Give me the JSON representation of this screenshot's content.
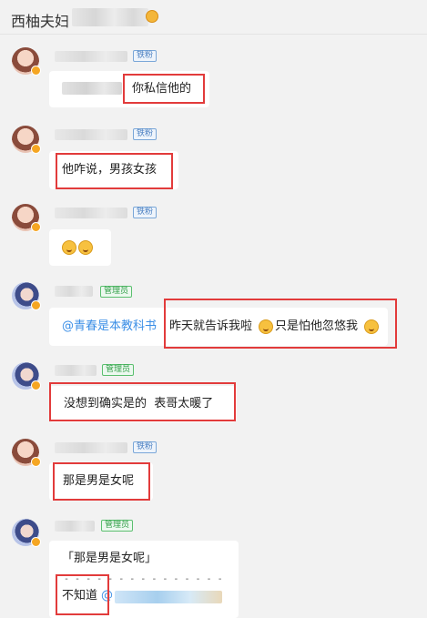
{
  "header": {
    "title": "西柚夫妇"
  },
  "messages": [
    {
      "tag": "铁粉",
      "text": "你私信他的"
    },
    {
      "tag": "铁粉",
      "text": "他咋说，男孩女孩"
    },
    {
      "tag": "铁粉",
      "emoji": "surprised-face-emoji"
    },
    {
      "tag": "管理员",
      "mention": "@青春是本教科书",
      "text": "昨天就告诉我啦",
      "emoji1": "grinning-sweat-emoji",
      "text2": "只是怕他忽悠我",
      "emoji2": "laughing-emoji"
    },
    {
      "tag": "管理员",
      "text": "没想到确实是的  表哥太暖了"
    },
    {
      "tag": "铁粉",
      "text": "那是男是女呢"
    },
    {
      "tag": "管理员",
      "quote": "「那是男是女呢」",
      "divider": "- - - - - - - - - - - - - - -",
      "text": "不知道",
      "mention": "@"
    }
  ],
  "colors": {
    "highlight": "#e23b3b",
    "mention": "#3a8ee6",
    "rank_tag": "#4a7fc1",
    "admin_tag": "#2f9e46"
  }
}
